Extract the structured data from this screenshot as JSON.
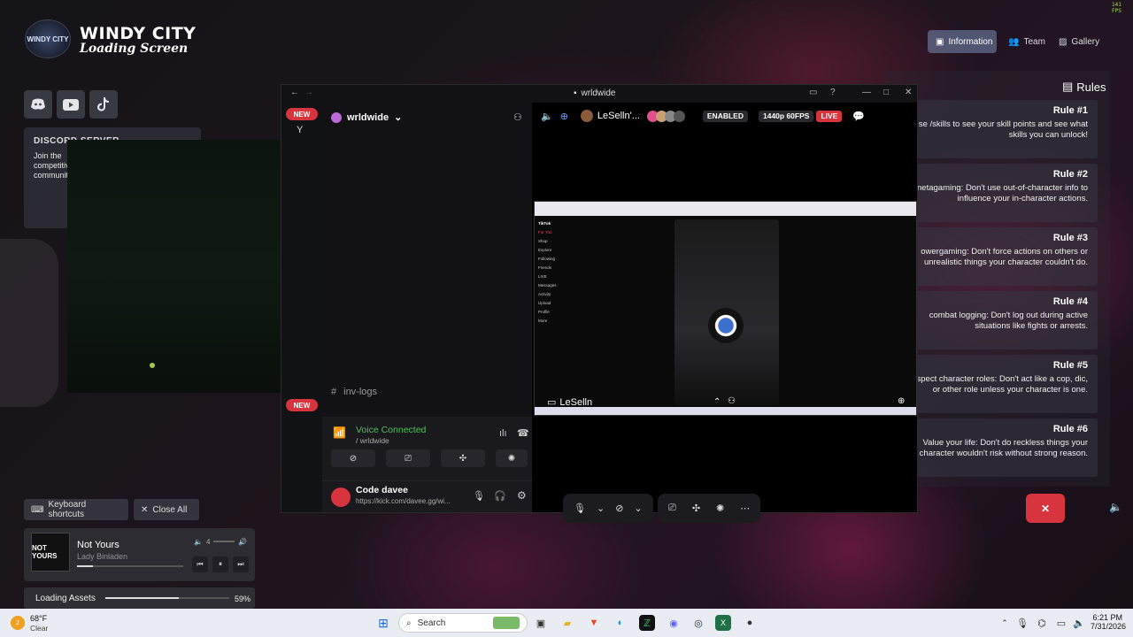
{
  "overlay": {
    "fps": "141 FPS"
  },
  "branding": {
    "logo_text": "WINDY CITY",
    "title": "WINDY CITY",
    "subtitle": "Loading Screen"
  },
  "social": [
    "discord-icon",
    "youtube-icon",
    "tiktok-icon"
  ],
  "discord_card": {
    "title": "DISCORD SERVER",
    "description": "Join the competitive community"
  },
  "shortcuts": {
    "keyboard": "Keyboard shortcuts",
    "close_all": "Close All"
  },
  "music": {
    "album_text": "NOT YOURS",
    "song": "Not Yours",
    "artist": "Lady Binladen",
    "volume": "4",
    "progress": 0.15
  },
  "loading": {
    "label": "Loading Assets",
    "percent": "59%",
    "progress": 0.59
  },
  "nav": {
    "information": "Information",
    "team": "Team",
    "gallery": "Gallery"
  },
  "rules": {
    "heading": "Rules",
    "items": [
      {
        "title": "Rule #1",
        "text": "se /skills to see your skill points and see what skills you can unlock!"
      },
      {
        "title": "Rule #2",
        "text": "netagaming: Don't use out-of-character info to influence your in-character actions."
      },
      {
        "title": "Rule #3",
        "text": "owergaming: Don't force actions on others or unrealistic things your character couldn't do."
      },
      {
        "title": "Rule #4",
        "text": "combat logging: Don't log out during active situations like fights or arrests."
      },
      {
        "title": "Rule #5",
        "text": "Respect character roles: Don't act like a cop, dic, or other role unless your character is one."
      },
      {
        "title": "Rule #6",
        "text": "Value your life: Don't do reckless things your character wouldn't risk without strong reason."
      }
    ]
  },
  "discord": {
    "window_title": "wrldwide",
    "new_badge": "NEW",
    "guild_letter": "Y",
    "server_name": "wrldwide",
    "channel": "inv-logs",
    "voice": {
      "status": "Voice Connected",
      "server": "/ wrldwide"
    },
    "user": {
      "name": "Code davee",
      "status": "https://kick.com/davee.gg/wi..."
    },
    "stage": {
      "streamer": "LeSelln'...",
      "enabled": "ENABLED",
      "quality": "1440p 60FPS",
      "live": "LIVE",
      "stream_label": "LeSelln",
      "tiktok_items": [
        "TikTok",
        "For You",
        "Shop",
        "Explore",
        "Following",
        "Friends",
        "LIVE",
        "Messages",
        "Activity",
        "Upload",
        "Profile",
        "More"
      ]
    }
  },
  "taskbar": {
    "weather_temp": "68°F",
    "weather_desc": "Clear",
    "search_placeholder": "Search",
    "time": "6:21 PM",
    "date": "7/31/2026",
    "notif_count": "2"
  }
}
